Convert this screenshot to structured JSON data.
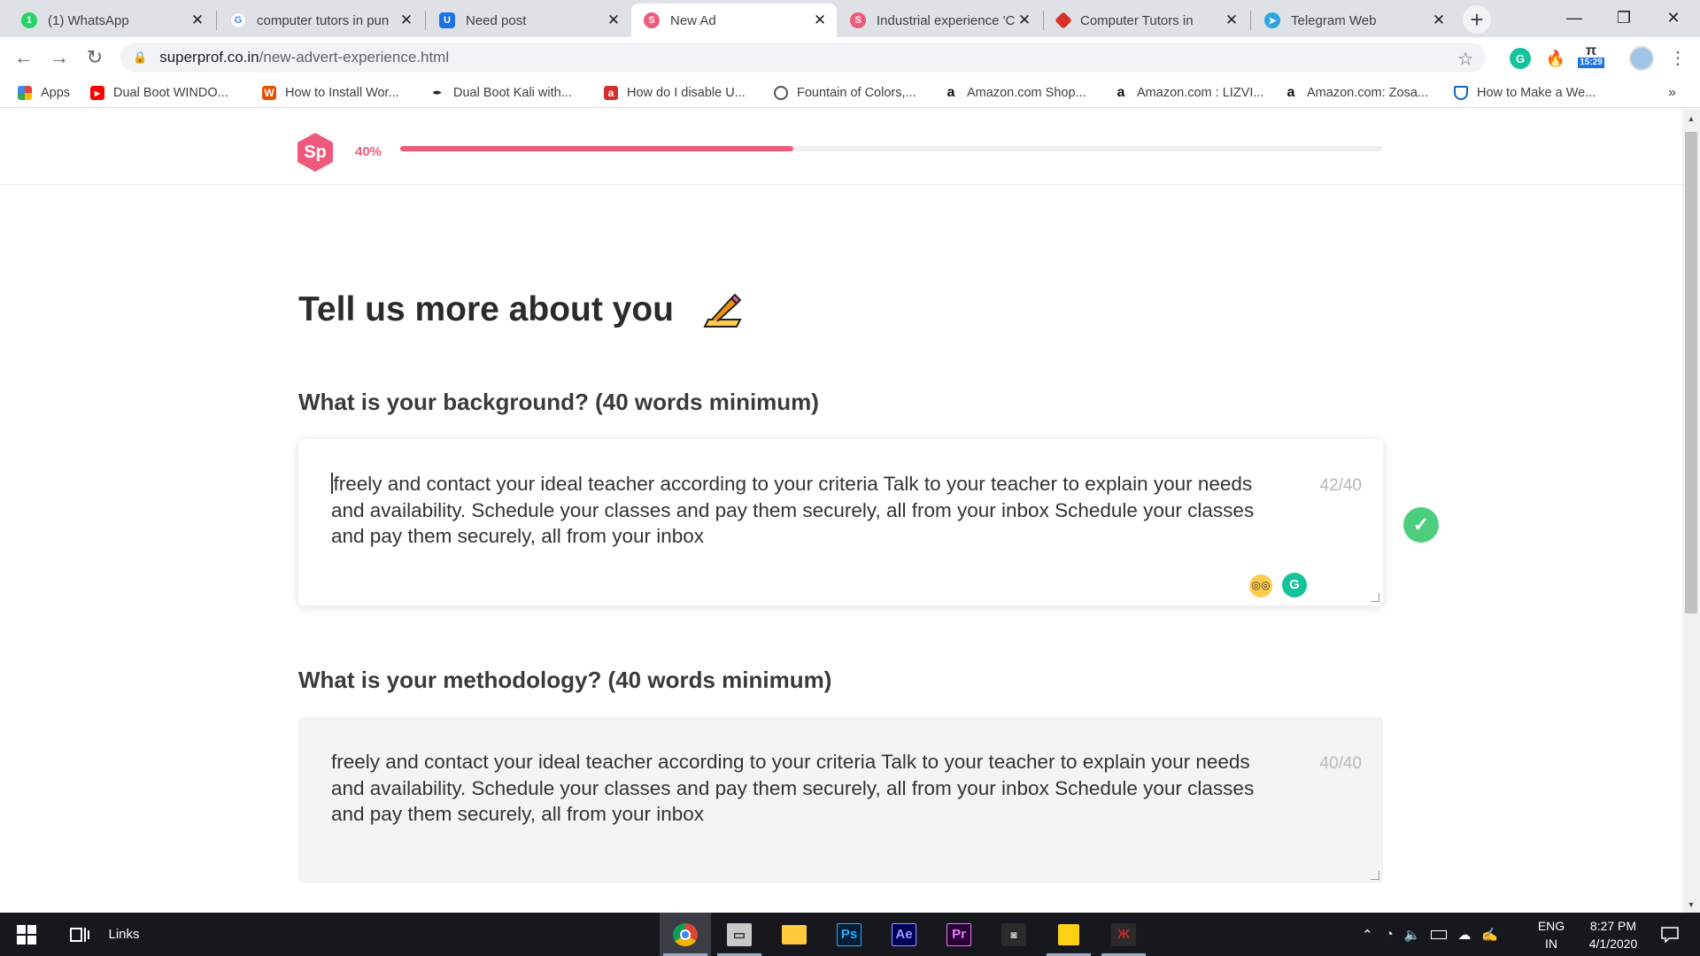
{
  "browser": {
    "tabs": [
      {
        "title": "(1) WhatsApp",
        "icon": "whatsapp-icon",
        "color": "#25d366"
      },
      {
        "title": "computer tutors in pun",
        "icon": "google-icon",
        "color": "#4285f4"
      },
      {
        "title": "Need post",
        "icon": "tab-favicon",
        "color": "#1a73e8"
      },
      {
        "title": "New Ad",
        "icon": "superprof-icon",
        "color": "#ed5a7c"
      },
      {
        "title": "Industrial experience 'C",
        "icon": "superprof-icon",
        "color": "#ed5a7c"
      },
      {
        "title": "Computer Tutors in",
        "icon": "laptop-icon",
        "color": "#d93025"
      },
      {
        "title": "Telegram Web",
        "icon": "telegram-icon",
        "color": "#2ca5e0"
      }
    ],
    "close_glyph": "✕",
    "new_tab_glyph": "+",
    "window_controls": {
      "minimize": "—",
      "restore": "❐",
      "close": "✕"
    },
    "nav": {
      "back": "←",
      "forward": "→",
      "reload": "↻"
    },
    "url_host": "superprof.co.in",
    "url_path": "/new-advert-experience.html",
    "lock_glyph": "🔒",
    "star_glyph": "☆",
    "extensions": [
      {
        "name": "grammarly-extension-icon",
        "label": "G",
        "color": "#15c39a"
      },
      {
        "name": "fire-extension-icon",
        "label": "🔥",
        "color": "#ff7043"
      },
      {
        "name": "timer-extension-icon",
        "label": "15:29",
        "color": "#1a73e8"
      },
      {
        "name": "profile-avatar-icon",
        "label": "",
        "color": "#9fc4e6"
      }
    ],
    "menu_glyph": "⋮",
    "bookmarks": [
      {
        "label": "Apps",
        "icon": "apps-grid-icon",
        "color": "#ea4335"
      },
      {
        "label": "Dual Boot WINDO...",
        "icon": "youtube-icon",
        "color": "#ff0000"
      },
      {
        "label": "How to Install Wor...",
        "icon": "w-icon",
        "color": "#e65100"
      },
      {
        "label": "Dual Boot Kali with...",
        "icon": "kali-icon",
        "color": "#222222"
      },
      {
        "label": "How do I disable U...",
        "icon": "bookmark-icon",
        "color": "#d32f2f"
      },
      {
        "label": "Fountain of Colors,...",
        "icon": "globe-icon",
        "color": "#555555"
      },
      {
        "label": "Amazon.com Shop...",
        "icon": "amazon-icon",
        "color": "#111111"
      },
      {
        "label": "Amazon.com : LIZVI...",
        "icon": "amazon-icon",
        "color": "#111111"
      },
      {
        "label": "Amazon.com: Zosa...",
        "icon": "amazon-icon",
        "color": "#111111"
      },
      {
        "label": "How to Make a We...",
        "icon": "shield-icon",
        "color": "#1565c0"
      }
    ],
    "bookmarks_overflow": "»"
  },
  "page": {
    "logo_text": "Sp",
    "progress": {
      "label": "40%",
      "value": 0.4
    },
    "heading": "Tell us more about you",
    "questions": [
      {
        "label": "What is your background? (40 words minimum)",
        "value": "freely and contact your ideal teacher according to your criteria Talk to your teacher to explain your needs and availability. Schedule your classes and pay them securely, all from your inbox Schedule your classes and pay them securely, all from your inbox",
        "count": "42/40"
      },
      {
        "label": "What is your methodology? (40 words minimum)",
        "value": "freely and contact your ideal teacher according to your criteria Talk to your teacher to explain your needs and availability. Schedule your classes and pay them securely, all from your inbox Schedule your classes and pay them securely, all from your inbox",
        "count": "40/40"
      }
    ],
    "check_glyph": "✓",
    "grammarly_label": "G"
  },
  "taskbar": {
    "links_label": "Links",
    "apps": [
      {
        "name": "chrome-taskbar-icon",
        "label": "",
        "color": "#db4437"
      },
      {
        "name": "explorer-taskbar-icon",
        "label": "",
        "color": "#c8c8c8"
      },
      {
        "name": "file-explorer-taskbar-icon",
        "label": "",
        "color": "#ffc83d"
      },
      {
        "name": "photoshop-taskbar-icon",
        "label": "Ps",
        "color": "#31a8ff"
      },
      {
        "name": "after-effects-taskbar-icon",
        "label": "Ae",
        "color": "#9999ff"
      },
      {
        "name": "premiere-taskbar-icon",
        "label": "Pr",
        "color": "#ea77ff"
      },
      {
        "name": "app-taskbar-icon",
        "label": "",
        "color": "#888888"
      },
      {
        "name": "sticky-notes-taskbar-icon",
        "label": "",
        "color": "#fcd116"
      },
      {
        "name": "predator-taskbar-icon",
        "label": "",
        "color": "#c62828"
      }
    ],
    "language": "ENG",
    "region": "IN",
    "time": "8:27 PM",
    "date": "4/1/2020"
  }
}
